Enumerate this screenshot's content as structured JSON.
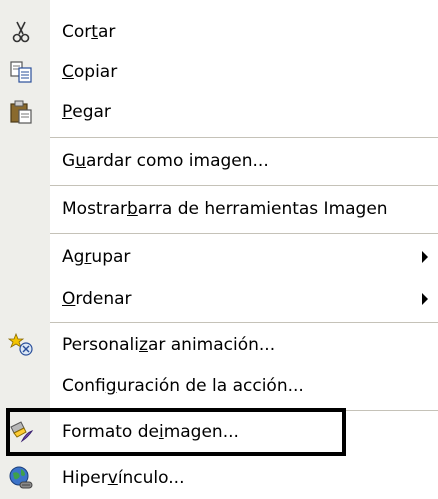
{
  "menu": {
    "items": [
      {
        "id": "cortar",
        "pre": "Cor",
        "key": "t",
        "post": "ar",
        "icon": "scissors-icon",
        "submenu": false
      },
      {
        "id": "copiar",
        "pre": "",
        "key": "C",
        "post": "opiar",
        "icon": "copy-icon",
        "submenu": false
      },
      {
        "id": "pegar",
        "pre": "",
        "key": "P",
        "post": "egar",
        "icon": "paste-icon",
        "submenu": false
      },
      {
        "id": "guardar-como-imagen",
        "pre": "G",
        "key": "u",
        "post": "ardar como imagen...",
        "icon": "",
        "submenu": false
      },
      {
        "id": "mostrar-barra",
        "pre": "Mostrar ",
        "key": "b",
        "post": "arra de herramientas Imagen",
        "icon": "",
        "submenu": false
      },
      {
        "id": "agrupar",
        "pre": "Ag",
        "key": "r",
        "post": "upar",
        "icon": "",
        "submenu": true
      },
      {
        "id": "ordenar",
        "pre": "",
        "key": "O",
        "post": "rdenar",
        "icon": "",
        "submenu": true
      },
      {
        "id": "personalizar-animacion",
        "pre": "Personali",
        "key": "z",
        "post": "ar animación...",
        "icon": "custom-animation-icon",
        "submenu": false
      },
      {
        "id": "configuracion-accion",
        "pre": "Confi",
        "key": "g",
        "post": "uración de la acción...",
        "icon": "",
        "submenu": false
      },
      {
        "id": "formato-imagen",
        "pre": "Formato de ",
        "key": "i",
        "post": "magen...",
        "icon": "format-picture-icon",
        "submenu": false
      },
      {
        "id": "hipervinculo",
        "pre": "Hiper",
        "key": "v",
        "post": "ínculo...",
        "icon": "hyperlink-icon",
        "submenu": false
      }
    ]
  },
  "colors": {
    "icon_strip": "#eeeeea",
    "separator": "#c5c2b8",
    "highlight_border": "#000000"
  }
}
